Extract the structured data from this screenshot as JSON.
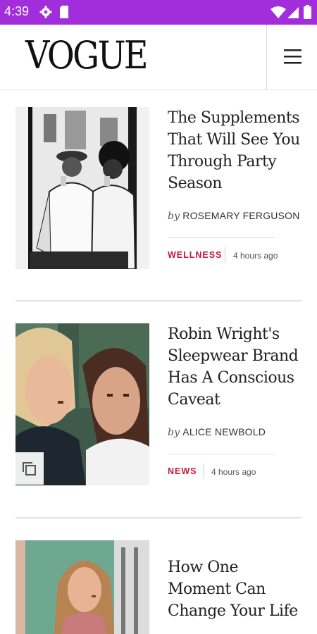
{
  "status_bar": {
    "time": "4:39",
    "icons": [
      "settings-gear-icon",
      "sd-card-icon",
      "wifi-icon",
      "cell-signal-icon",
      "battery-icon"
    ],
    "bg_color": "#a12ddb"
  },
  "header": {
    "logo": "VOGUE",
    "menu_icon": "hamburger-menu-icon"
  },
  "articles": [
    {
      "title": "The Supplements That Will See You Through Party Season",
      "by": "by",
      "author": "ROSEMARY FERGUSON",
      "category": "WELLNESS",
      "time": "4 hours ago",
      "image": "black-and-white-photo-two-women-drinking"
    },
    {
      "title": "Robin Wright's Sleepwear Brand Has A Conscious Caveat",
      "by": "by",
      "author": "ALICE NEWBOLD",
      "category": "NEWS",
      "time": "4 hours ago",
      "image": "photo-two-women-portrait",
      "badge_icon": "gallery-icon"
    },
    {
      "title": "How One Moment Can Change Your Life",
      "image": "photo-woman-in-green-room"
    }
  ],
  "colors": {
    "accent": "#c4183c"
  }
}
